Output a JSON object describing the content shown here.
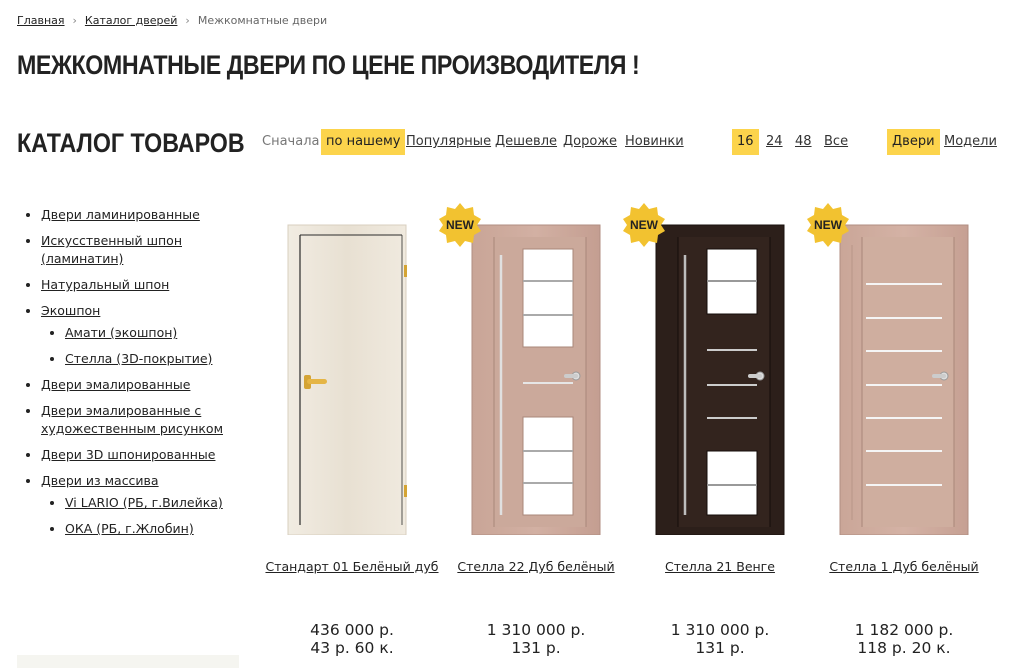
{
  "breadcrumb": {
    "home": "Главная",
    "catalog": "Каталог дверей",
    "current": "Межкомнатные двери"
  },
  "page_title": "МЕЖКОМНАТНЫЕ ДВЕРИ ПО ЦЕНЕ ПРОИЗВОДИТЕЛЯ !",
  "catalog_title": "КАТАЛОГ ТОВАРОВ",
  "sort": {
    "label": "Сначала",
    "options": [
      "по нашему",
      "Популярные",
      "Дешевле",
      "Дороже",
      "Новинки"
    ],
    "active": "по нашему"
  },
  "per_page": {
    "options": [
      "16",
      "24",
      "48",
      "Все"
    ],
    "active": "16"
  },
  "view": {
    "options": [
      "Двери",
      "Модели"
    ],
    "active": "Двери"
  },
  "sidebar": {
    "items": [
      {
        "label": "Двери ламинированные"
      },
      {
        "label": "Искусственный шпон (ламинатин)"
      },
      {
        "label": "Натуральный шпон"
      },
      {
        "label": "Экошпон",
        "children": [
          "Амати (экошпон)",
          "Стелла (3D-покрытие)"
        ]
      },
      {
        "label": "Двери эмалированные"
      },
      {
        "label": "Двери эмалированные с художественным рисунком"
      },
      {
        "label": "Двери 3D шпонированные"
      },
      {
        "label": "Двери из массива",
        "children": [
          "Vi LARIO (РБ, г.Вилейка)",
          "ОКА (РБ, г.Жлобин)"
        ]
      }
    ]
  },
  "colors": {
    "accent": "#fcd44c",
    "badge": "#f2c230",
    "venge": "#2c1f1a",
    "oak": "#caa698",
    "white_door": "#ede6da"
  },
  "products": [
    {
      "name": "Стандарт 01 Белёный дуб",
      "price": "436 000 р.",
      "price_new": "43 р. 60 к.",
      "badge": "",
      "style": "white"
    },
    {
      "name": "Стелла 22 Дуб белёный",
      "price": "1 310 000 р.",
      "price_new": "131 р.",
      "badge": "NEW",
      "style": "oak-glass"
    },
    {
      "name": "Стелла 21 Венге",
      "price": "1 310 000 р.",
      "price_new": "131 р.",
      "badge": "NEW",
      "style": "venge-glass"
    },
    {
      "name": "Стелла 1 Дуб белёный",
      "price": "1 182 000 р.",
      "price_new": "118 р. 20 к.",
      "badge": "NEW",
      "style": "oak-lines"
    }
  ]
}
